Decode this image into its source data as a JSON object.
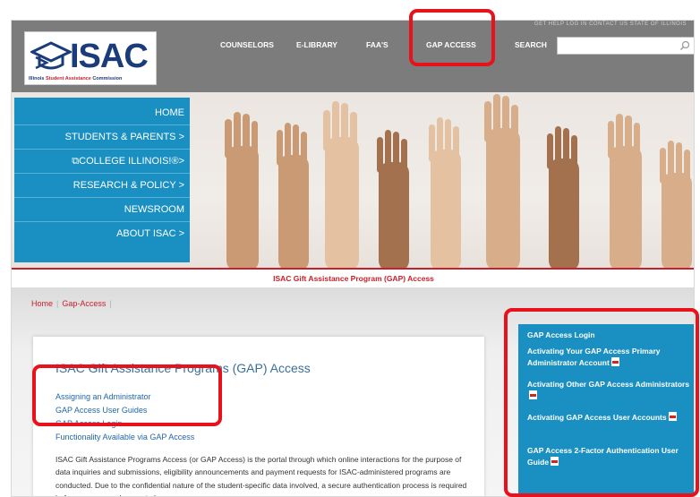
{
  "header": {
    "top_util": "GET HELP  LOG IN  CONTACT US  STATE OF ILLINOIS",
    "logo_text": "ISAC",
    "logo_sub_prefix": "Illinois ",
    "logo_sub_red": "Student Assistance",
    "logo_sub_suffix": " Commission",
    "nav": [
      {
        "label": "COUNSELORS"
      },
      {
        "label": "E-LIBRARY"
      },
      {
        "label": "FAA'S"
      },
      {
        "label": "GAP ACCESS"
      },
      {
        "label": "SEARCH"
      }
    ],
    "search_placeholder": ""
  },
  "sidemenu": {
    "items": [
      {
        "label": "HOME"
      },
      {
        "label": "STUDENTS & PARENTS >"
      },
      {
        "label": "⧉COLLEGE ILLINOIS!®>"
      },
      {
        "label": "RESEARCH & POLICY >"
      },
      {
        "label": "NEWSROOM"
      },
      {
        "label": "ABOUT ISAC >"
      }
    ]
  },
  "program_title": "ISAC Gift Assistance Program (GAP) Access",
  "breadcrumb": {
    "home": "Home",
    "current": "Gap-Access"
  },
  "main": {
    "title": "ISAC Gift Assistance Programs (GAP) Access",
    "links": [
      {
        "label": "Assigning an Administrator"
      },
      {
        "label": "GAP Access User Guides"
      },
      {
        "label": "GAP Access Login"
      },
      {
        "label": "Functionality Available via GAP Access"
      }
    ],
    "paragraph": "ISAC Gift Assistance Programs Access (or GAP Access) is the portal through which online interactions for the purpose of data inquiries and submissions, eligibility announcements and payment requests for ISAC-administered programs are conducted.  Due to the confidential nature of the student-specific data involved, a secure authentication process is required before access can be granted."
  },
  "rpanel": {
    "items": [
      {
        "label": "GAP Access Login",
        "pdf": false
      },
      {
        "label": "Activating Your GAP Access Primary Administrator Account",
        "pdf": true
      },
      {
        "label": "Activating Other GAP Access Administrators",
        "pdf": true
      },
      {
        "label": "Activating GAP Access User Accounts",
        "pdf": true
      },
      {
        "label": "GAP Access 2-Factor Authentication User Guide",
        "pdf": true
      }
    ]
  },
  "colors": {
    "accent_blue": "#1a8fc1",
    "brand_red": "#c8202a",
    "highlight_red": "#e8121c",
    "header_gray": "#7c7c7c"
  }
}
